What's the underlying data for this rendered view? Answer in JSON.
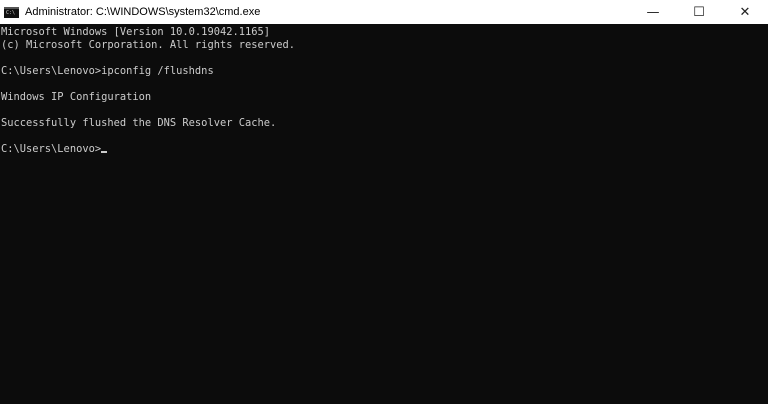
{
  "window": {
    "title": "Administrator: C:\\WINDOWS\\system32\\cmd.exe",
    "app_icon": "command-prompt-icon",
    "icon_glyph": "C:\\",
    "controls": {
      "minimize": "—",
      "maximize": "☐",
      "close": "✕"
    }
  },
  "console": {
    "text_color": "#cccccc",
    "background": "#0c0c0c",
    "lines": [
      "Microsoft Windows [Version 10.0.19042.1165]",
      "(c) Microsoft Corporation. All rights reserved.",
      "",
      "C:\\Users\\Lenovo>ipconfig /flushdns",
      "",
      "Windows IP Configuration",
      "",
      "Successfully flushed the DNS Resolver Cache.",
      "",
      "C:\\Users\\Lenovo>"
    ]
  }
}
